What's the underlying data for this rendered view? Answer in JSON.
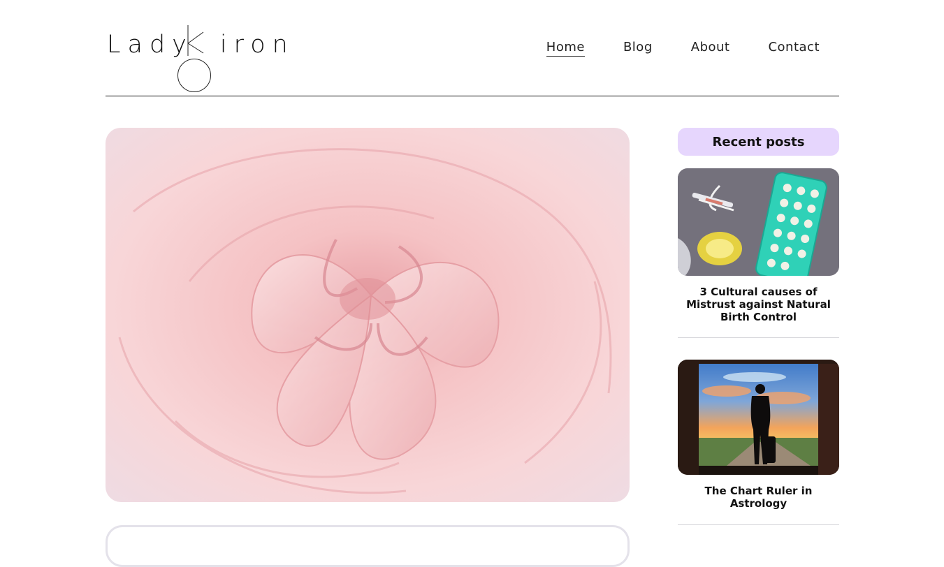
{
  "brand": {
    "logo_text_left": "Lady",
    "logo_text_right": "iron",
    "logo_letter": "K"
  },
  "nav": [
    {
      "label": "Home",
      "active": true
    },
    {
      "label": "Blog",
      "active": false
    },
    {
      "label": "About",
      "active": false
    },
    {
      "label": "Contact",
      "active": false
    }
  ],
  "hero": {
    "image": "pink-rose-close-up"
  },
  "sidebar": {
    "heading": "Recent posts",
    "heading_color": "#e6d6fd",
    "posts": [
      {
        "title": "3 Cultural causes of Mistrust against Natural Birth Control",
        "image": "contraceptives-photo"
      },
      {
        "title": "The Chart Ruler in Astrology",
        "image": "silhouette-sunset-doorway-photo"
      }
    ]
  }
}
